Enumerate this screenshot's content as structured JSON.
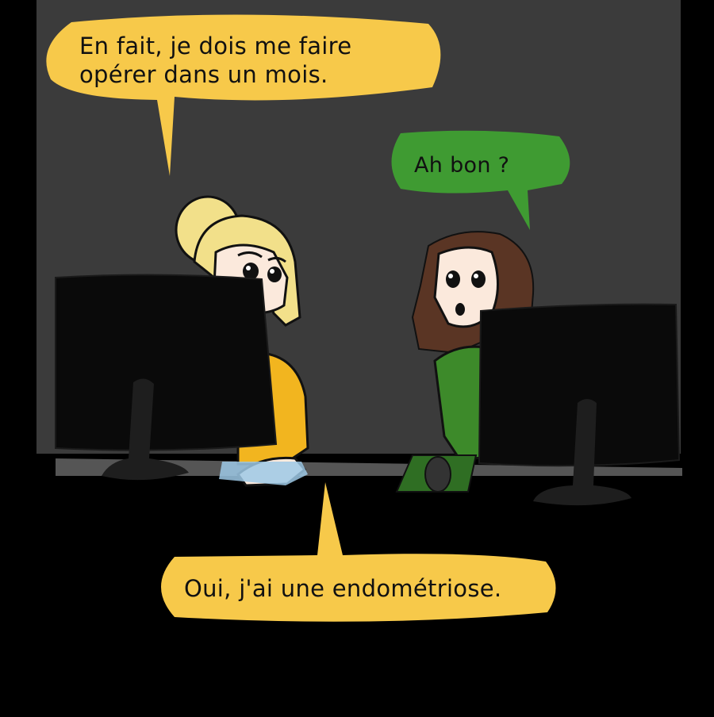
{
  "panel": {
    "colors": {
      "background_outer": "#000000",
      "wall": "#3b3b3b",
      "desk": "#000000",
      "bubble_yellow": "#f7c94a",
      "bubble_green": "#3f9b32",
      "sweater_yellow": "#f2b51f",
      "sweater_green": "#3d8a2a",
      "hair_blonde": "#f2e08a",
      "hair_brown": "#5a3524",
      "skin": "#fbe9dc",
      "monitor": "#0a0a0a"
    },
    "bubbles": {
      "top_yellow": {
        "line1": "En fait, je dois me faire",
        "line2": "opérer dans un mois."
      },
      "green": {
        "text": "Ah bon ?"
      },
      "bottom_yellow": {
        "text": "Oui, j'ai une endométriose."
      }
    },
    "characters": [
      {
        "name": "blonde-woman",
        "sweater": "yellow"
      },
      {
        "name": "brunette-woman",
        "sweater": "green"
      }
    ]
  }
}
